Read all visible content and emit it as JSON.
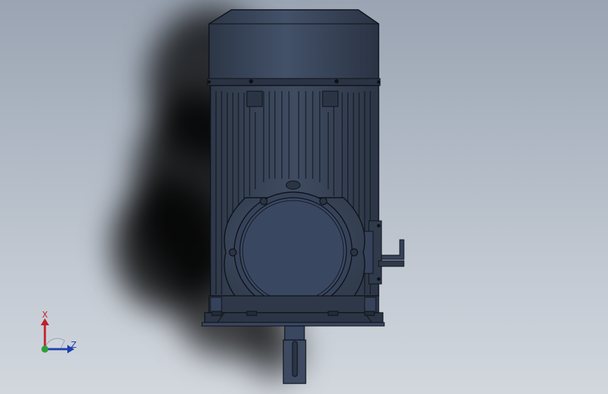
{
  "viewport": {
    "model": "electric-motor",
    "view": "top",
    "colors": {
      "background_top": "#9aa4b2",
      "background_bottom": "#d2d7de",
      "body": "#3c4a5e",
      "body_dark": "#2a3444",
      "edge": "#0d1118",
      "axis_x": "#c0202a",
      "axis_y": "#2e9e3a",
      "axis_z": "#1e3fae"
    }
  },
  "triad": {
    "x_label": "X",
    "z_label": "Z",
    "icon": "axis-triad-icon"
  }
}
